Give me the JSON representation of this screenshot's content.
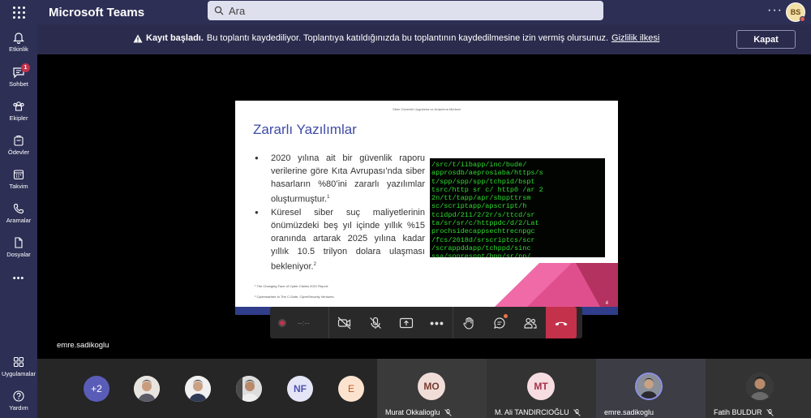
{
  "app": {
    "title": "Microsoft Teams",
    "user_initials": "BS"
  },
  "search": {
    "placeholder": "Ara"
  },
  "sidebar": {
    "items": [
      {
        "label": "Etkinlik",
        "icon": "bell-icon"
      },
      {
        "label": "Sohbet",
        "icon": "chat-icon",
        "badge": "1"
      },
      {
        "label": "Ekipler",
        "icon": "teams-icon"
      },
      {
        "label": "Ödevler",
        "icon": "assignments-icon"
      },
      {
        "label": "Takvim",
        "icon": "calendar-icon"
      },
      {
        "label": "Aramalar",
        "icon": "phone-icon"
      },
      {
        "label": "Dosyalar",
        "icon": "file-icon"
      }
    ],
    "more": "•••",
    "bottom": [
      {
        "label": "Uygulamalar",
        "icon": "apps-icon"
      },
      {
        "label": "Yardım",
        "icon": "help-icon"
      }
    ]
  },
  "banner": {
    "title": "Kayıt başladı.",
    "message": "Bu toplantı kaydediliyor. Toplantıya katıldığınızda bu toplantının kaydedilmesine izin vermiş olursunuz.",
    "link": "Gizlilik ilkesi",
    "close_label": "Kapat"
  },
  "slide": {
    "header": "Siber Güvenlik Uygulama ve Araştırma Merkezi",
    "title": "Zararlı Yazılımlar",
    "bullets": [
      {
        "text": "2020 yılına ait bir güvenlik raporu verilerine göre Kıta Avrupası’nda siber hasarların %80’ini zararlı yazılımlar oluşturmuştur.",
        "ref": "1"
      },
      {
        "text": "Küresel siber suç maliyetlerinin önümüzdeki beş yıl içinde yıllık %15 oranında artarak 2025 yılına kadar yıllık 10.5 trilyon dolara ulaşması bekleniyor.",
        "ref": "2"
      }
    ],
    "footnotes": [
      "¹ The Changing Face of Cyber Claims 2021 Report.",
      "² Cyberwarfare In The C-Suite, CyberSecurity Ventures."
    ],
    "page_number": "4"
  },
  "toolbar": {
    "timer": "--:--"
  },
  "self_video": {
    "name": "emre.sadikoglu"
  },
  "participants": {
    "overflow": "+2",
    "avatars": [
      {
        "initials": "NF",
        "color": "#e4e6f7",
        "text_color": "#4f52b2"
      },
      {
        "initials": "E",
        "color": "#fbe3cf",
        "text_color": "#c35a1b"
      }
    ],
    "tiles": [
      {
        "initials": "MO",
        "name": "Murat Okkalioglu",
        "color": "#f1ddd8",
        "text_color": "#7a3b2e"
      },
      {
        "initials": "MT",
        "name": "M. Ali TANDIRCIOĞLU",
        "color": "#f6dde2",
        "text_color": "#a33447"
      },
      {
        "initials": "",
        "name": "emre.sadikoglu",
        "color": "#555",
        "text_color": "#fff"
      },
      {
        "initials": "",
        "name": "Fatih BULDUR",
        "color": "#555",
        "text_color": "#fff"
      }
    ]
  }
}
